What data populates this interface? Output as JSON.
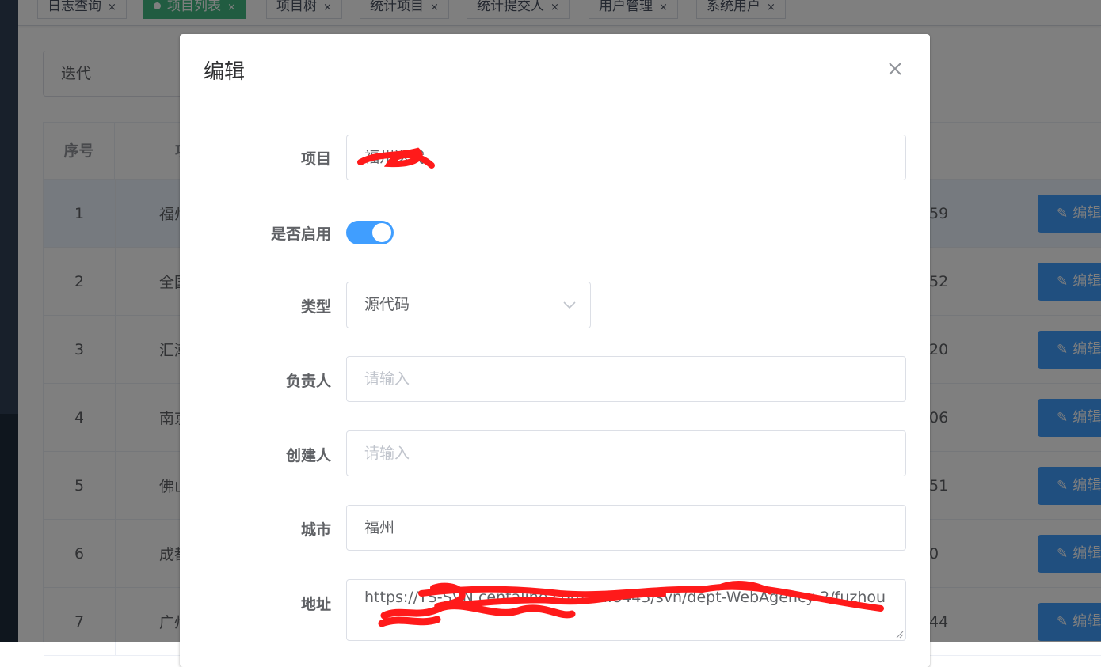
{
  "tabs": [
    {
      "label": "日志查询",
      "active": false
    },
    {
      "label": "项目列表",
      "active": true
    },
    {
      "label": "项目树",
      "active": false
    },
    {
      "label": "统计项目",
      "active": false
    },
    {
      "label": "统计提交人",
      "active": false
    },
    {
      "label": "用户管理",
      "active": false
    },
    {
      "label": "系统用户",
      "active": false
    }
  ],
  "tab_close_glyph": "×",
  "filter": {
    "value": "迭代"
  },
  "table": {
    "header_index": "序号",
    "header_name_partial": "项",
    "rows": [
      {
        "index": "1",
        "name_partial": "福州",
        "tail": "59",
        "edit": "编辑"
      },
      {
        "index": "2",
        "name_partial": "全国",
        "tail": "52",
        "edit": "编辑"
      },
      {
        "index": "3",
        "name_partial": "汇潮",
        "tail": "20",
        "edit": "编辑"
      },
      {
        "index": "4",
        "name_partial": "南京",
        "tail": "06",
        "edit": "编辑"
      },
      {
        "index": "5",
        "name_partial": "佛山",
        "tail": "51",
        "edit": "编辑"
      },
      {
        "index": "6",
        "name_partial": "成都",
        "tail": "0",
        "edit": "编辑"
      },
      {
        "index": "7",
        "name_partial": "广州",
        "tail": "44",
        "edit": "编辑"
      }
    ]
  },
  "dialog": {
    "title": "编辑",
    "fields": {
      "project_label": "项目",
      "project_value": "福州迭代",
      "enabled_label": "是否启用",
      "enabled": true,
      "type_label": "类型",
      "type_value": "源代码",
      "owner_label": "负责人",
      "owner_placeholder": "请输入",
      "creator_label": "创建人",
      "creator_placeholder": "请输入",
      "city_label": "城市",
      "city_value": "福州",
      "address_label": "地址",
      "address_value": "https://TS-SVN.centaline.com.cn:8443/svn/dept-WebAgency-2/fuzhou"
    }
  },
  "colors": {
    "primary": "#409eff",
    "tag_active": "#42b983",
    "redaction": "#ff1a1a"
  }
}
